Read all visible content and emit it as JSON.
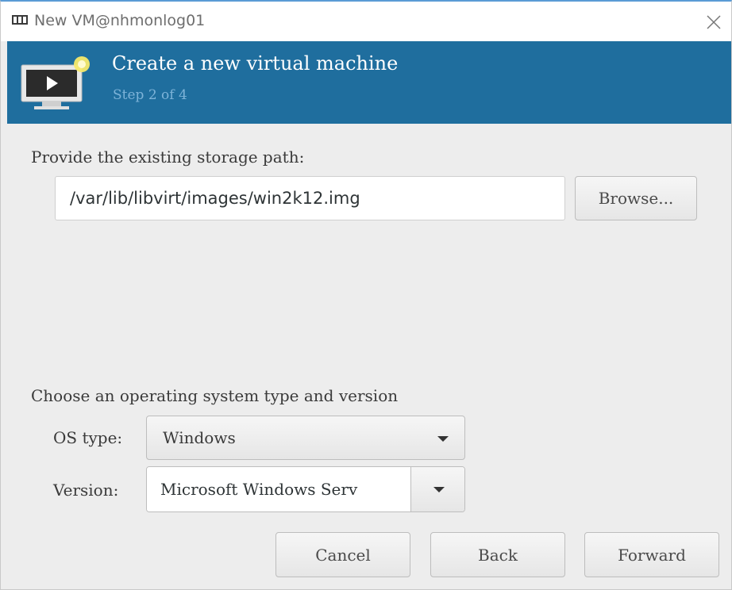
{
  "window": {
    "title": "New VM@nhmonlog01",
    "close_glyph": "×"
  },
  "banner": {
    "title": "Create a new virtual machine",
    "step": "Step 2 of 4",
    "icon": "virtual-machine-monitor-icon",
    "background_color": "#1f6e9e"
  },
  "storage": {
    "label": "Provide the existing storage path:",
    "path_value": "/var/lib/libvirt/images/win2k12.img",
    "browse_label": "Browse..."
  },
  "os": {
    "section_label": "Choose an operating system type and version",
    "type_label": "OS type:",
    "type_value": "Windows",
    "version_label": "Version:",
    "version_value": "Microsoft Windows Serv"
  },
  "buttons": {
    "cancel": "Cancel",
    "back": "Back",
    "forward": "Forward"
  }
}
